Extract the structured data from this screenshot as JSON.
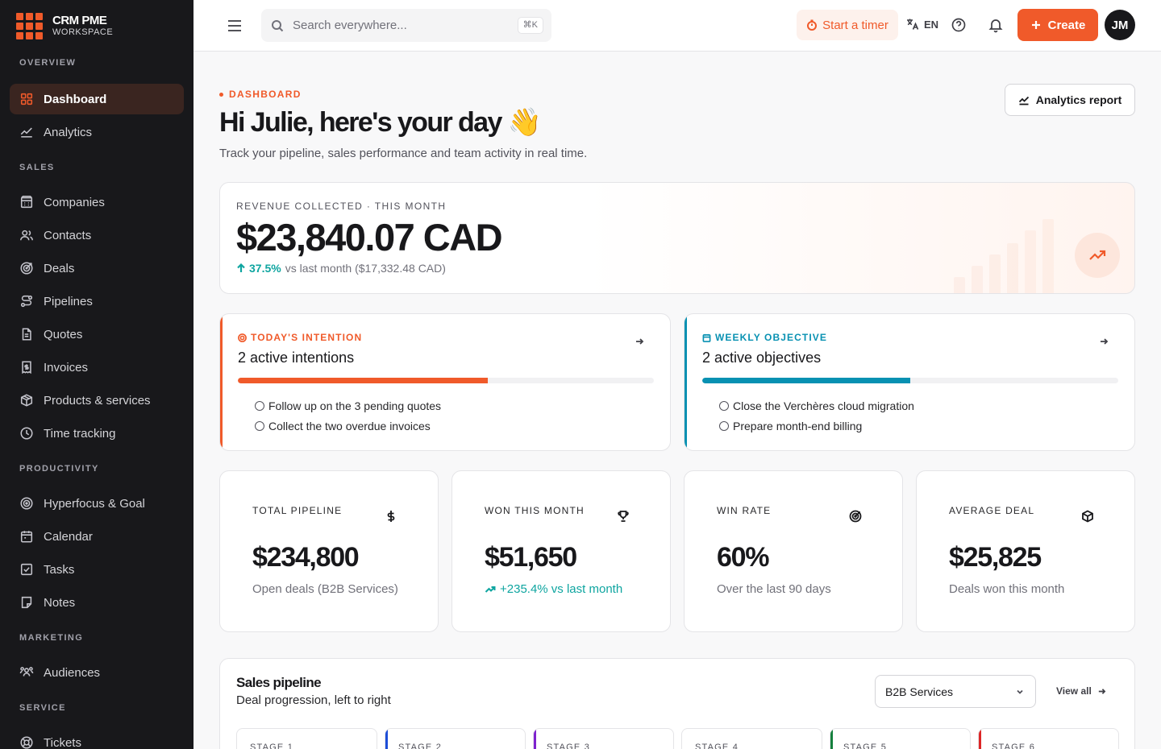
{
  "brand": {
    "name": "CRM PME",
    "sub": "WORKSPACE"
  },
  "sidebar": {
    "sections": [
      {
        "label": "OVERVIEW",
        "items": [
          {
            "label": "Dashboard",
            "icon": "grid-icon",
            "active": true
          },
          {
            "label": "Analytics",
            "icon": "chart-line-icon"
          }
        ]
      },
      {
        "label": "SALES",
        "items": [
          {
            "label": "Companies",
            "icon": "building-icon"
          },
          {
            "label": "Contacts",
            "icon": "users-icon"
          },
          {
            "label": "Deals",
            "icon": "target-icon"
          },
          {
            "label": "Pipelines",
            "icon": "route-icon"
          },
          {
            "label": "Quotes",
            "icon": "file-icon"
          },
          {
            "label": "Invoices",
            "icon": "receipt-icon"
          },
          {
            "label": "Products & services",
            "icon": "box-icon"
          },
          {
            "label": "Time tracking",
            "icon": "clock-icon"
          }
        ]
      },
      {
        "label": "PRODUCTIVITY",
        "items": [
          {
            "label": "Hyperfocus & Goal",
            "icon": "focus-icon"
          },
          {
            "label": "Calendar",
            "icon": "calendar-icon"
          },
          {
            "label": "Tasks",
            "icon": "checkbox-icon"
          },
          {
            "label": "Notes",
            "icon": "note-icon"
          }
        ]
      },
      {
        "label": "MARKETING",
        "items": [
          {
            "label": "Audiences",
            "icon": "audience-icon"
          }
        ]
      },
      {
        "label": "SERVICE",
        "items": [
          {
            "label": "Tickets",
            "icon": "lifebuoy-icon"
          }
        ]
      }
    ]
  },
  "topbar": {
    "search_placeholder": "Search everywhere...",
    "shortcut": "⌘K",
    "timer_label": "Start a timer",
    "lang": "EN",
    "create_label": "Create",
    "avatar_initials": "JM"
  },
  "header": {
    "eyebrow": "DASHBOARD",
    "greeting": "Hi Julie, here's your day 👋",
    "subtitle": "Track your pipeline, sales performance and team activity in real time.",
    "analytics_button": "Analytics report"
  },
  "revenue": {
    "label": "REVENUE COLLECTED · THIS MONTH",
    "amount": "$23,840.07 CAD",
    "delta_pct": "37.5%",
    "delta_text": "vs last month ($17,332.48 CAD)"
  },
  "focus_cards": [
    {
      "label": "TODAY'S INTENTION",
      "count_text": "2 active intentions",
      "color": "#f05a2a",
      "progress": 0.6,
      "items": [
        "Follow up on the 3 pending quotes",
        "Collect the two overdue invoices"
      ]
    },
    {
      "label": "WEEKLY OBJECTIVE",
      "count_text": "2 active objectives",
      "color": "#0891b2",
      "progress": 0.5,
      "items": [
        "Close the Verchères cloud migration",
        "Prepare month-end billing"
      ]
    }
  ],
  "kpis": [
    {
      "label": "TOTAL PIPELINE",
      "value": "$234,800",
      "sub": "Open deals (B2B Services)",
      "icon": "dollar-icon"
    },
    {
      "label": "WON THIS MONTH",
      "value": "$51,650",
      "sub": "+235.4% vs last month",
      "icon": "trophy-icon",
      "positive": true
    },
    {
      "label": "WIN RATE",
      "value": "60%",
      "sub": "Over the last 90 days",
      "icon": "target-icon"
    },
    {
      "label": "AVERAGE DEAL",
      "value": "$25,825",
      "sub": "Deals won this month",
      "icon": "cube-icon"
    }
  ],
  "pipeline": {
    "title": "Sales pipeline",
    "subtitle": "Deal progression, left to right",
    "select_value": "B2B Services",
    "view_all": "View all",
    "stages": [
      {
        "label": "STAGE 1",
        "color": ""
      },
      {
        "label": "STAGE 2",
        "color": "#1d4ed8"
      },
      {
        "label": "STAGE 3",
        "color": "#7e22ce"
      },
      {
        "label": "STAGE 4",
        "color": ""
      },
      {
        "label": "STAGE 5",
        "color": "#15803d"
      },
      {
        "label": "STAGE 6",
        "color": "#dc2626"
      }
    ]
  }
}
